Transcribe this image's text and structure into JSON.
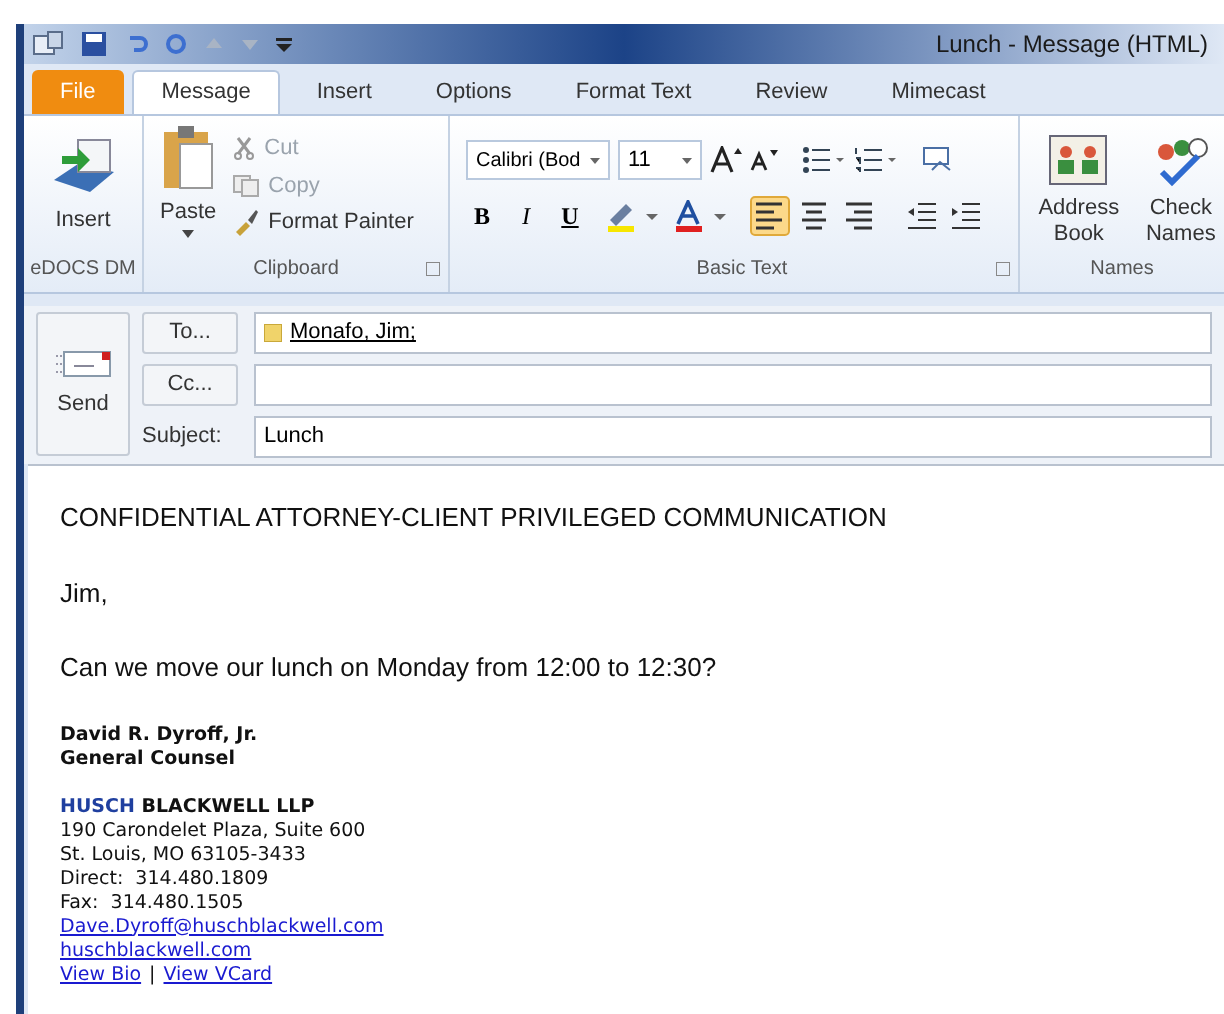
{
  "window": {
    "title": "Lunch  -  Message (HTML)"
  },
  "tabs": [
    {
      "label": "File",
      "kind": "file",
      "selected": false
    },
    {
      "label": "Message",
      "kind": "tab",
      "selected": true
    },
    {
      "label": "Insert",
      "kind": "tab",
      "selected": false
    },
    {
      "label": "Options",
      "kind": "tab",
      "selected": false
    },
    {
      "label": "Format Text",
      "kind": "tab",
      "selected": false
    },
    {
      "label": "Review",
      "kind": "tab",
      "selected": false
    },
    {
      "label": "Mimecast",
      "kind": "tab",
      "selected": false
    }
  ],
  "ribbon": {
    "edocs": {
      "insert": "Insert",
      "group": "eDOCS DM"
    },
    "clipboard": {
      "paste": "Paste",
      "cut": {
        "label": "Cut",
        "disabled": true
      },
      "copy": {
        "label": "Copy",
        "disabled": true
      },
      "format_painter": {
        "label": "Format Painter",
        "disabled": false
      },
      "group": "Clipboard"
    },
    "basic_text": {
      "font": "Calibri (Bod",
      "size": "11",
      "bold": "B",
      "italic": "I",
      "underline": "U",
      "align": [
        {
          "kind": "left",
          "selected": true
        },
        {
          "kind": "center",
          "selected": false
        },
        {
          "kind": "right",
          "selected": false
        }
      ],
      "group": "Basic Text"
    },
    "names": {
      "address_book": "Address Book",
      "check_names": "Check Names",
      "group": "Names"
    }
  },
  "compose": {
    "send": "Send",
    "to_button": "To...",
    "cc_button": "Cc...",
    "subject_label": "Subject:",
    "to": "Monafo, Jim;",
    "subject": "Lunch"
  },
  "body": {
    "lines": [
      "CONFIDENTIAL ATTORNEY-CLIENT PRIVILEGED COMMUNICATION",
      "Jim,",
      "Can we move our lunch on Monday from 12:00 to 12:30?"
    ],
    "signature": {
      "name": "David R. Dyroff, Jr.",
      "title": "General Counsel",
      "firm_first": "HUSCH",
      "firm_rest": "BLACKWELL LLP",
      "address": [
        "190 Carondelet Plaza, Suite 600",
        "St. Louis, MO 63105-3433",
        "Direct:  314.480.1809",
        "Fax:  314.480.1505"
      ],
      "email": "Dave.Dyroff@huschblackwell.com",
      "website": "huschblackwell.com",
      "bio": "View Bio",
      "separator": "|",
      "vcard": "View VCard"
    }
  }
}
